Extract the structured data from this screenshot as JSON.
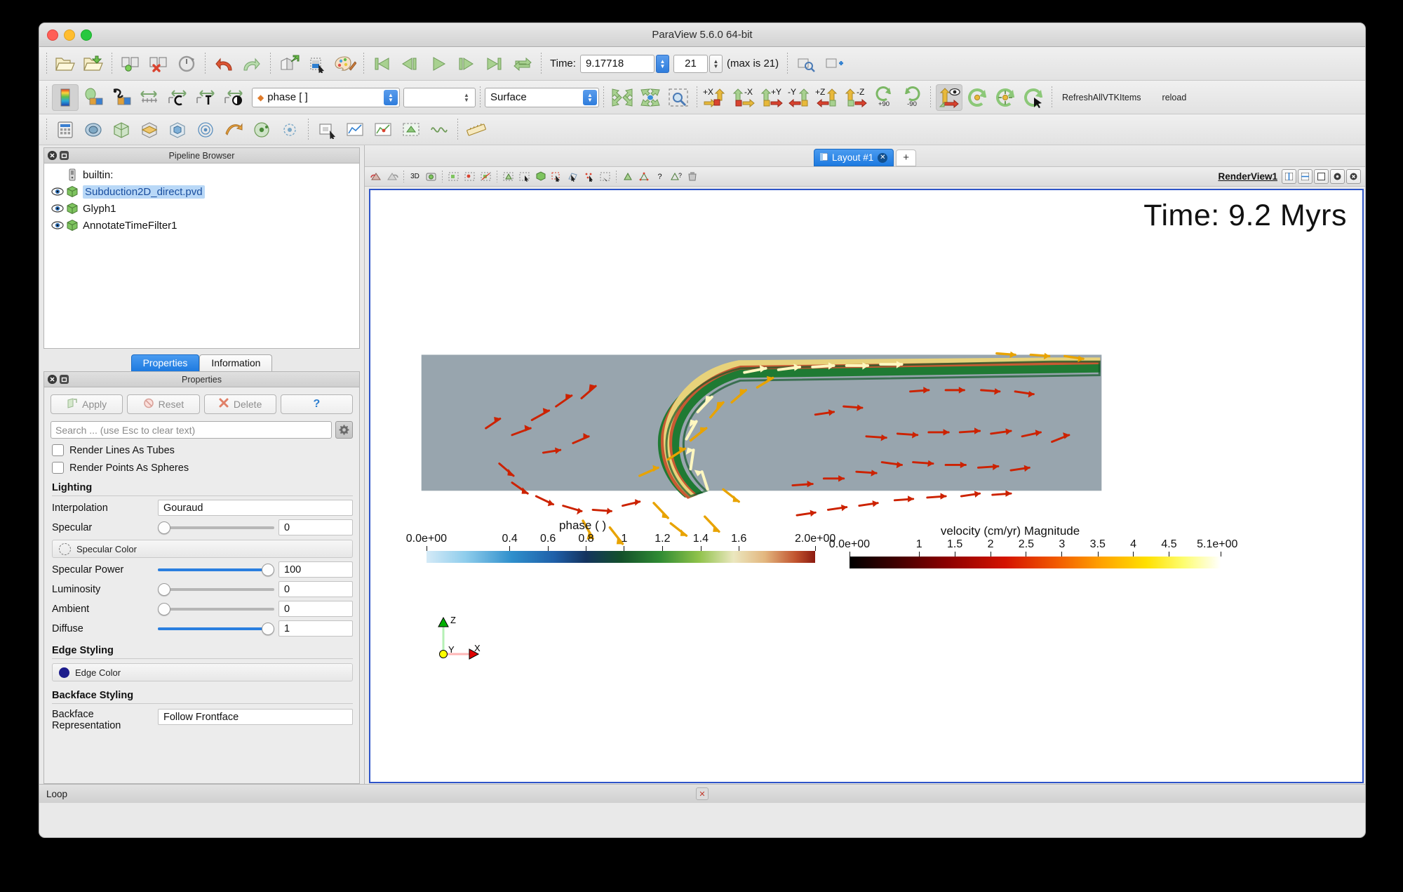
{
  "window": {
    "title": "ParaView 5.6.0 64-bit"
  },
  "main_toolbar": {
    "icons": [
      "open-file-icon",
      "open-recent-icon",
      "connect-server-icon",
      "disconnect-server-icon",
      "server-timeout-icon",
      "undo-icon",
      "redo-icon",
      "camera-undo-icon",
      "select-color-icon",
      "edit-color-map-icon"
    ],
    "vcr": [
      "first-frame-icon",
      "previous-frame-icon",
      "play-icon",
      "next-frame-icon",
      "last-frame-icon",
      "loop-icon"
    ],
    "time_label": "Time:",
    "time_value": "9.17718",
    "frame_value": "21",
    "max_label": "(max is 21)",
    "trailing_icons": [
      "zoom-to-data-icon",
      "add-camera-icon"
    ]
  },
  "representation_toolbar": {
    "icons": [
      "color-map-icon",
      "color-legend-icon",
      "edit-color-map-icon",
      "rescale-to-data-range-icon",
      "rescale-to-custom-range-icon",
      "rescale-to-temporal-range-icon",
      "rescale-to-visible-range-icon"
    ],
    "array_value": "phase [ ]",
    "component_value": "",
    "representation_value": "Surface",
    "camera_icons": [
      "reset-camera-icon",
      "zoom-to-data-icon",
      "zoom-to-box-icon"
    ],
    "axis_buttons": [
      "+X",
      "-X",
      "+Y",
      "-Y",
      "+Z",
      "-Z"
    ],
    "rotate_labels": [
      "+90",
      "-90"
    ],
    "right_icons": [
      "show-center-axes-icon",
      "reset-center-icon",
      "pick-center-icon",
      "reset-camera-closest-icon"
    ],
    "macro_buttons": [
      "RefreshAllVTKItems",
      "reload"
    ]
  },
  "filters_toolbar": {
    "icons": [
      "calculator-icon",
      "contour-icon",
      "clip-icon",
      "slice-icon",
      "threshold-icon",
      "extract-subset-icon",
      "glyph-icon",
      "stream-tracer-icon",
      "warp-icon",
      "group-datasets-icon",
      "extract-level-icon",
      "plot-over-line-icon",
      "plot-selection-icon",
      "extract-selection-icon",
      "wavelet-icon",
      "ruler-icon"
    ]
  },
  "pipeline_browser": {
    "title": "Pipeline Browser",
    "items": [
      {
        "name": "builtin:",
        "icon": "server-icon",
        "eye": false,
        "selected": false,
        "link": false
      },
      {
        "name": "Subduction2D_direct.pvd",
        "icon": "dataset-icon",
        "eye": true,
        "selected": true,
        "link": true
      },
      {
        "name": "Glyph1",
        "icon": "filter-icon",
        "eye": true,
        "selected": false,
        "link": false
      },
      {
        "name": "AnnotateTimeFilter1",
        "icon": "filter-icon",
        "eye": true,
        "selected": false,
        "link": false
      }
    ]
  },
  "panel_tabs": [
    {
      "label": "Properties",
      "active": true
    },
    {
      "label": "Information",
      "active": false
    }
  ],
  "properties_panel": {
    "title": "Properties",
    "buttons": [
      {
        "label": "Apply",
        "icon": "apply-icon"
      },
      {
        "label": "Reset",
        "icon": "reset-icon"
      },
      {
        "label": "Delete",
        "icon": "delete-icon"
      },
      {
        "label": "?",
        "icon": "help-icon"
      }
    ],
    "search_placeholder": "Search ... (use Esc to clear text)",
    "checkboxes": [
      {
        "label": "Render Lines As Tubes",
        "checked": false
      },
      {
        "label": "Render Points As Spheres",
        "checked": false
      }
    ],
    "groups": [
      {
        "title": "Lighting",
        "rows": [
          {
            "kind": "combo",
            "label": "Interpolation",
            "value": "Gouraud"
          },
          {
            "kind": "slider",
            "label": "Specular",
            "value": "0",
            "fill": 0
          },
          {
            "kind": "color",
            "label": "Specular Color",
            "swatch": "hollow"
          },
          {
            "kind": "slider",
            "label": "Specular Power",
            "value": "100",
            "fill": 100
          },
          {
            "kind": "slider",
            "label": "Luminosity",
            "value": "0",
            "fill": 0
          },
          {
            "kind": "slider",
            "label": "Ambient",
            "value": "0",
            "fill": 0
          },
          {
            "kind": "slider",
            "label": "Diffuse",
            "value": "1",
            "fill": 100
          }
        ]
      },
      {
        "title": "Edge Styling",
        "rows": [
          {
            "kind": "color",
            "label": "Edge Color",
            "swatch": "#1c1c8c"
          }
        ]
      },
      {
        "title": "Backface Styling",
        "rows": [
          {
            "kind": "combo",
            "label": "Backface Representation",
            "value": "Follow Frontface"
          }
        ]
      }
    ]
  },
  "layout": {
    "tab_label": "Layout #1",
    "close_glyph": "✕",
    "plus_label": "+",
    "view_name": "RenderView1",
    "view_buttons": [
      "split-horizontal-icon",
      "split-vertical-icon",
      "maximize-icon",
      "settings-icon",
      "close-view-icon"
    ]
  },
  "render_view": {
    "time_annotation": "Time: 9.2 Myrs",
    "orientation_axes": {
      "x": "X",
      "y": "Y",
      "z": "Z"
    }
  },
  "status_bar": {
    "text": "Loop",
    "close_glyph": "✕"
  },
  "chart_data": [
    {
      "type": "heatmap",
      "name": "phase-color-legend",
      "title": "phase ( )",
      "ticks": [
        "0.0e+00",
        "0.4",
        "0.6",
        "0.8",
        "1",
        "1.2",
        "1.4",
        "1.6",
        "2.0e+00"
      ],
      "tick_positions": [
        0.0,
        0.4,
        0.6,
        0.8,
        1.0,
        1.2,
        1.4,
        1.6,
        2.0
      ],
      "range": [
        0.0,
        2.0
      ],
      "colormap": [
        "#d4eaf7",
        "#4aa8dc",
        "#1f6fb4",
        "#173a6e",
        "#13492a",
        "#2f8b33",
        "#8fc24a",
        "#e7e3bb",
        "#e0b27c",
        "#c1532e",
        "#8c1a10"
      ],
      "orientation": "horizontal"
    },
    {
      "type": "heatmap",
      "name": "velocity-magnitude-color-legend",
      "title": "velocity (cm/yr) Magnitude",
      "ticks": [
        "0.0e+00",
        "1",
        "1.5",
        "2",
        "2.5",
        "3",
        "3.5",
        "4",
        "4.5",
        "5.1e+00"
      ],
      "tick_positions": [
        0.0,
        1.0,
        1.5,
        2.0,
        2.5,
        3.0,
        3.5,
        4.0,
        4.5,
        5.1
      ],
      "range": [
        0.0,
        5.1
      ],
      "colormap": [
        "#000000",
        "#3d0000",
        "#8a0000",
        "#d41300",
        "#f25b00",
        "#ffa300",
        "#ffe000",
        "#fdfd60",
        "#ffffd0",
        "#ffffff"
      ],
      "orientation": "horizontal"
    }
  ]
}
